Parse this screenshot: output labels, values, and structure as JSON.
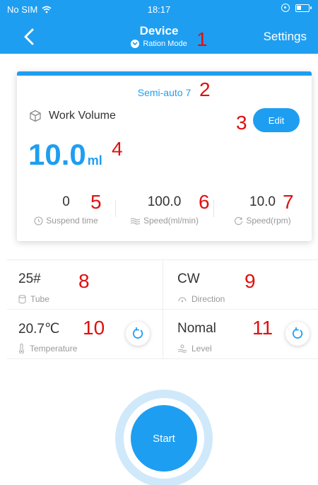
{
  "status_bar": {
    "carrier": "No SIM",
    "time": "18:17"
  },
  "header": {
    "title": "Device",
    "mode": "Ration Mode",
    "settings_label": "Settings"
  },
  "card": {
    "mode_label": "Semi-auto 7",
    "work_volume_label": "Work Volume",
    "edit_label": "Edit",
    "volume_value": "10.0",
    "volume_unit": "ml",
    "stats": [
      {
        "value": "0",
        "label": "Suspend time"
      },
      {
        "value": "100.0",
        "label": "Speed(ml/min)"
      },
      {
        "value": "10.0",
        "label": "Speed(rpm)"
      }
    ]
  },
  "info": {
    "tube": {
      "value": "25#",
      "label": "Tube"
    },
    "direction": {
      "value": "CW",
      "label": "Direction"
    },
    "temperature": {
      "value": "20.7℃",
      "label": "Temperature"
    },
    "level": {
      "value": "Nomal",
      "label": "Level"
    }
  },
  "start_label": "Start",
  "annotations": [
    "1",
    "2",
    "3",
    "4",
    "5",
    "6",
    "7",
    "8",
    "9",
    "10",
    "11"
  ],
  "colors": {
    "accent": "#1e9ef1",
    "annotation": "#e01010"
  }
}
